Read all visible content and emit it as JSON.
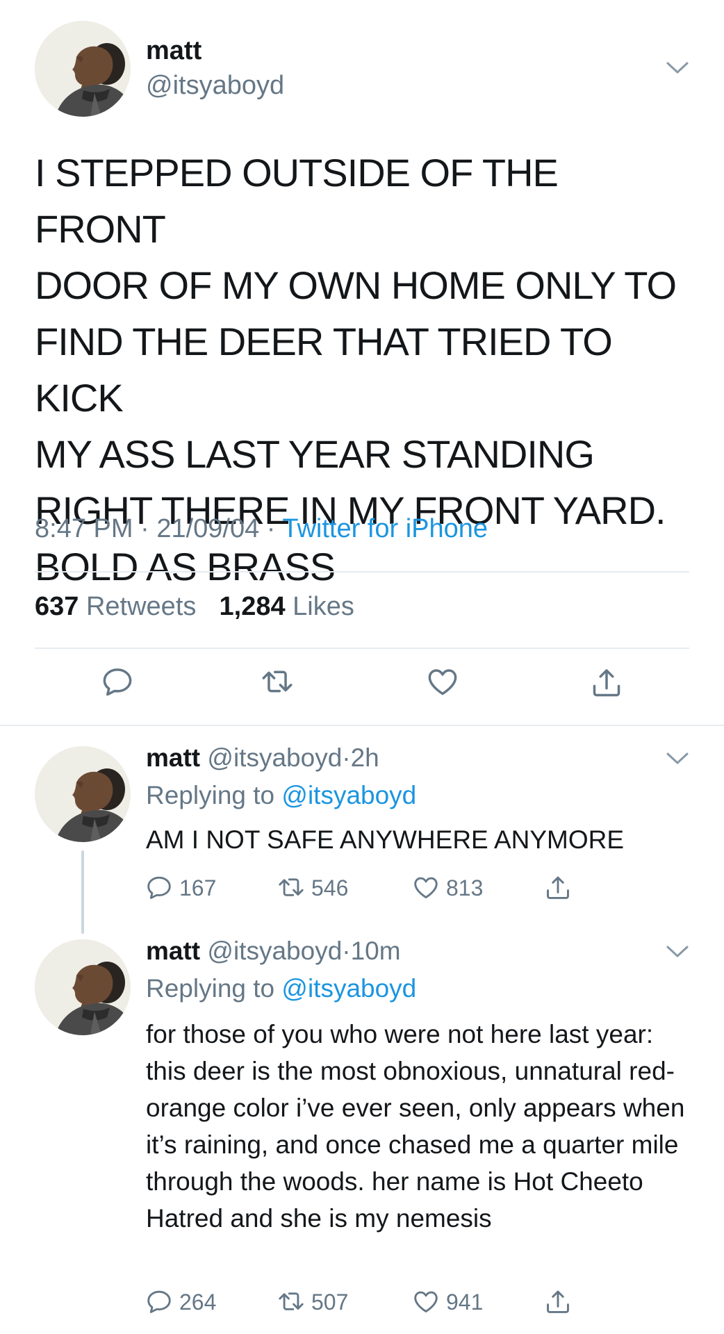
{
  "main_tweet": {
    "name": "matt",
    "handle": "@itsyaboyd",
    "text": "I STEPPED OUTSIDE OF THE FRONT\nDOOR OF MY OWN HOME ONLY TO\nFIND THE DEER THAT TRIED TO KICK\nMY ASS LAST YEAR STANDING\nRIGHT THERE IN MY FRONT YARD.\nBOLD AS BRASS",
    "time": "8:47 PM",
    "date": "21/09/04",
    "separator": "·",
    "source": "Twitter for iPhone",
    "retweet_count": "637",
    "retweet_label": "Retweets",
    "like_count": "1,284",
    "like_label": "Likes",
    "actions": [
      "reply-icon",
      "retweet-icon",
      "like-icon",
      "share-icon"
    ]
  },
  "replies": [
    {
      "name": "matt",
      "handle": "@itsyaboyd",
      "separator": "·",
      "time": "2h",
      "replying_label": "Replying to",
      "replying_to": "@itsyaboyd",
      "text": "AM I NOT SAFE ANYWHERE ANYMORE",
      "reply_count": "167",
      "retweet_count": "546",
      "like_count": "813"
    },
    {
      "name": "matt",
      "handle": "@itsyaboyd",
      "separator": "·",
      "time": "10m",
      "replying_label": "Replying to",
      "replying_to": "@itsyaboyd",
      "text": "for those of you who were not here last year: this deer is the most obnoxious, unnatural red-orange color i’ve ever seen, only appears when it’s raining, and once chased me a quarter mile through the woods. her name is Hot Cheeto Hatred and she is my nemesis",
      "reply_count": "264",
      "retweet_count": "507",
      "like_count": "941"
    }
  ],
  "colors": {
    "text": "#14171a",
    "secondary": "#657786",
    "link": "#1b95e0",
    "divider": "#e6ecf0",
    "thread_line": "#ccd6dd"
  }
}
